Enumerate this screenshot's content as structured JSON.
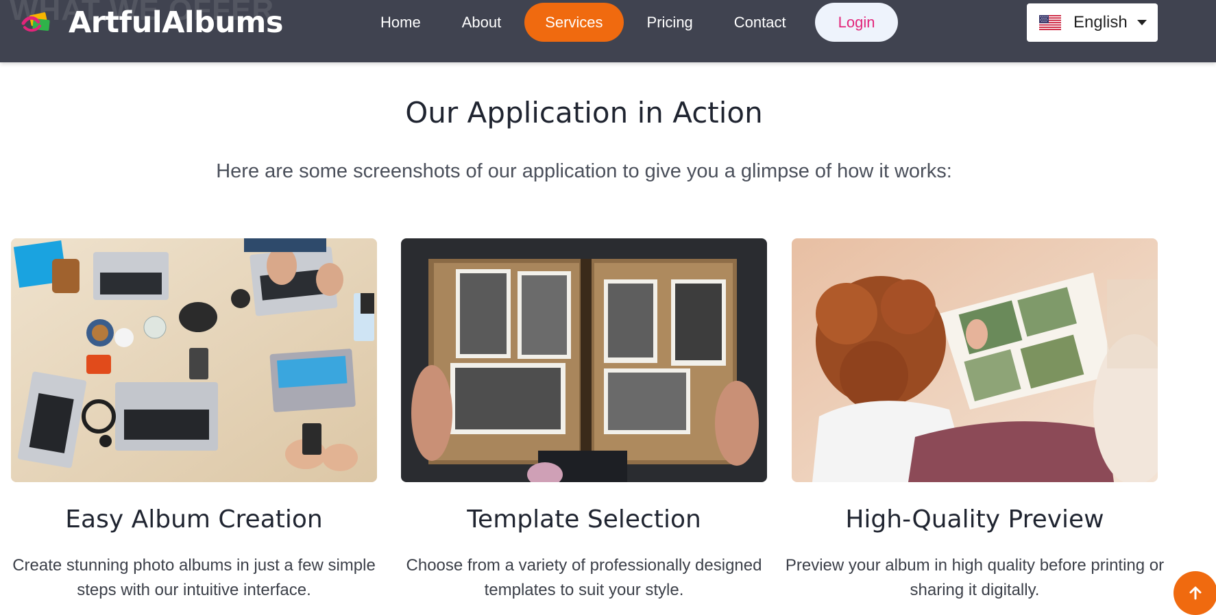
{
  "brand": {
    "name": "ArtfulAlbums",
    "watermark": "WHAT WE OFFER"
  },
  "nav": {
    "items": [
      {
        "label": "Home"
      },
      {
        "label": "About"
      },
      {
        "label": "Services"
      },
      {
        "label": "Pricing"
      },
      {
        "label": "Contact"
      }
    ],
    "active": "Services",
    "login_label": "Login"
  },
  "language": {
    "selected": "English",
    "flag_icon": "us-flag-icon"
  },
  "section": {
    "title": "Our Application in Action",
    "subtitle": "Here are some screenshots of our application to give you a glimpse of how it works:"
  },
  "cards": [
    {
      "title": "Easy Album Creation",
      "text": "Create stunning photo albums in just a few simple steps with our intuitive interface."
    },
    {
      "title": "Template Selection",
      "text": "Choose from a variety of professionally designed templates to suit your style."
    },
    {
      "title": "High-Quality Preview",
      "text": "Preview your album in high quality before printing or sharing it digitally."
    }
  ],
  "colors": {
    "nav_bg": "#404350",
    "accent": "#f06a0f",
    "login_text": "#e2257a",
    "login_bg": "#eef3fc"
  },
  "icons": {
    "scroll_top": "arrow-up-icon",
    "language_caret": "caret-down-icon"
  }
}
